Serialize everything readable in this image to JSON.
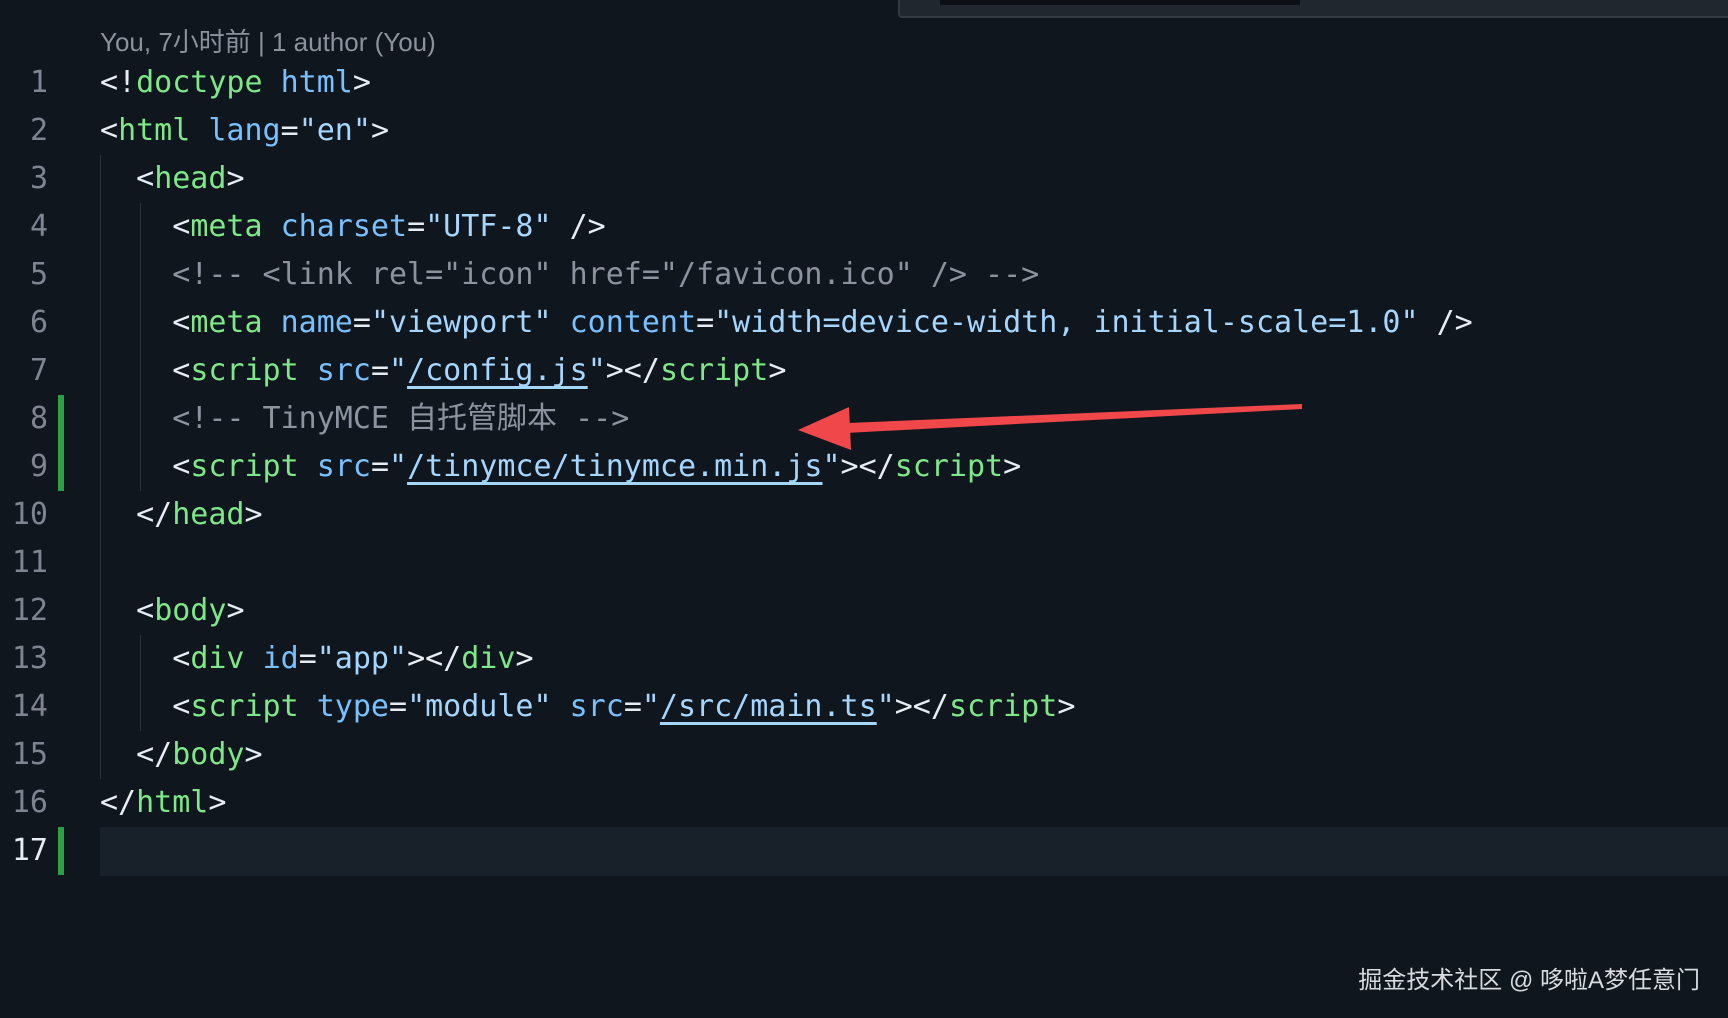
{
  "blame": "You, 7小时前 | 1 author (You)",
  "watermark": "掘金技术社区 @ 哆啦A梦任意门",
  "colors": {
    "background": "#0f161e",
    "tag": "#7ee787",
    "attribute": "#79c0ff",
    "string": "#a5d6ff",
    "comment": "#8b949e",
    "git_added": "#2ea043",
    "arrow": "#f0474b"
  },
  "lines": [
    {
      "num": "1",
      "parts": [
        [
          "p",
          "<!"
        ],
        [
          "tag",
          "doctype"
        ],
        [
          "p",
          " "
        ],
        [
          "attr",
          "html"
        ],
        [
          "p",
          ">"
        ]
      ]
    },
    {
      "num": "2",
      "parts": [
        [
          "p",
          "<"
        ],
        [
          "tag",
          "html"
        ],
        [
          "p",
          " "
        ],
        [
          "attr",
          "lang"
        ],
        [
          "p",
          "="
        ],
        [
          "str",
          "\"en\""
        ],
        [
          "p",
          ">"
        ]
      ]
    },
    {
      "num": "3",
      "parts": [
        [
          "p",
          "  <"
        ],
        [
          "tag",
          "head"
        ],
        [
          "p",
          ">"
        ]
      ]
    },
    {
      "num": "4",
      "parts": [
        [
          "p",
          "    <"
        ],
        [
          "tag",
          "meta"
        ],
        [
          "p",
          " "
        ],
        [
          "attr",
          "charset"
        ],
        [
          "p",
          "="
        ],
        [
          "str",
          "\"UTF-8\""
        ],
        [
          "p",
          " />"
        ]
      ]
    },
    {
      "num": "5",
      "parts": [
        [
          "com",
          "    <!-- <link rel=\"icon\" href=\"/favicon.ico\" /> -->"
        ]
      ]
    },
    {
      "num": "6",
      "parts": [
        [
          "p",
          "    <"
        ],
        [
          "tag",
          "meta"
        ],
        [
          "p",
          " "
        ],
        [
          "attr",
          "name"
        ],
        [
          "p",
          "="
        ],
        [
          "str",
          "\"viewport\""
        ],
        [
          "p",
          " "
        ],
        [
          "attr",
          "content"
        ],
        [
          "p",
          "="
        ],
        [
          "str",
          "\"width=device-width, initial-scale=1.0\""
        ],
        [
          "p",
          " />"
        ]
      ]
    },
    {
      "num": "7",
      "parts": [
        [
          "p",
          "    <"
        ],
        [
          "tag",
          "script"
        ],
        [
          "p",
          " "
        ],
        [
          "attr",
          "src"
        ],
        [
          "p",
          "="
        ],
        [
          "str",
          "\""
        ],
        [
          "link",
          "/config.js"
        ],
        [
          "str",
          "\""
        ],
        [
          "p",
          "></"
        ],
        [
          "tag",
          "script"
        ],
        [
          "p",
          ">"
        ]
      ]
    },
    {
      "num": "8",
      "parts": [
        [
          "com",
          "    <!-- TinyMCE 自托管脚本 -->"
        ]
      ]
    },
    {
      "num": "9",
      "parts": [
        [
          "p",
          "    <"
        ],
        [
          "tag",
          "script"
        ],
        [
          "p",
          " "
        ],
        [
          "attr",
          "src"
        ],
        [
          "p",
          "="
        ],
        [
          "str",
          "\""
        ],
        [
          "link",
          "/tinymce/tinymce.min.js"
        ],
        [
          "str",
          "\""
        ],
        [
          "p",
          "></"
        ],
        [
          "tag",
          "script"
        ],
        [
          "p",
          ">"
        ]
      ]
    },
    {
      "num": "10",
      "parts": [
        [
          "p",
          "  </"
        ],
        [
          "tag",
          "head"
        ],
        [
          "p",
          ">"
        ]
      ]
    },
    {
      "num": "11",
      "parts": []
    },
    {
      "num": "12",
      "parts": [
        [
          "p",
          "  <"
        ],
        [
          "tag",
          "body"
        ],
        [
          "p",
          ">"
        ]
      ]
    },
    {
      "num": "13",
      "parts": [
        [
          "p",
          "    <"
        ],
        [
          "tag",
          "div"
        ],
        [
          "p",
          " "
        ],
        [
          "attr",
          "id"
        ],
        [
          "p",
          "="
        ],
        [
          "str",
          "\"app\""
        ],
        [
          "p",
          "></"
        ],
        [
          "tag",
          "div"
        ],
        [
          "p",
          ">"
        ]
      ]
    },
    {
      "num": "14",
      "parts": [
        [
          "p",
          "    <"
        ],
        [
          "tag",
          "script"
        ],
        [
          "p",
          " "
        ],
        [
          "attr",
          "type"
        ],
        [
          "p",
          "="
        ],
        [
          "str",
          "\"module\""
        ],
        [
          "p",
          " "
        ],
        [
          "attr",
          "src"
        ],
        [
          "p",
          "="
        ],
        [
          "str",
          "\""
        ],
        [
          "link",
          "/src/main.ts"
        ],
        [
          "str",
          "\""
        ],
        [
          "p",
          "></"
        ],
        [
          "tag",
          "script"
        ],
        [
          "p",
          ">"
        ]
      ]
    },
    {
      "num": "15",
      "parts": [
        [
          "p",
          "  </"
        ],
        [
          "tag",
          "body"
        ],
        [
          "p",
          ">"
        ]
      ]
    },
    {
      "num": "16",
      "parts": [
        [
          "p",
          "</"
        ],
        [
          "tag",
          "html"
        ],
        [
          "p",
          ">"
        ]
      ]
    },
    {
      "num": "17",
      "parts": [],
      "active": true
    }
  ]
}
